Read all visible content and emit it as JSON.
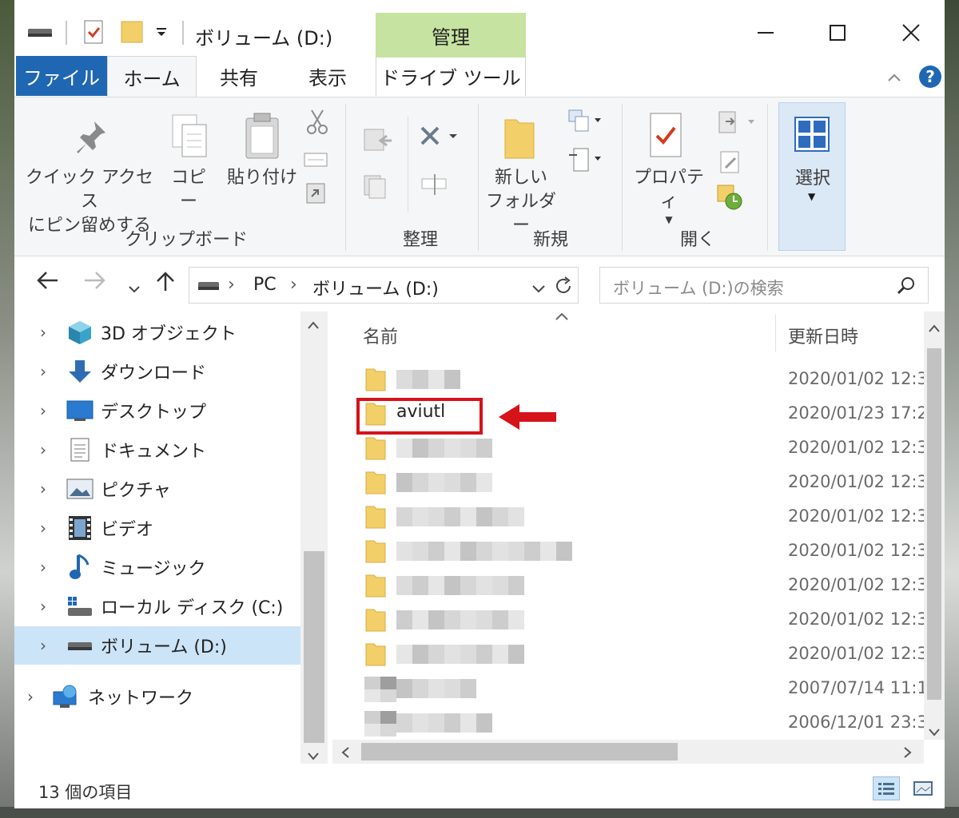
{
  "window": {
    "title": "ボリューム (D:)",
    "manage_tab": "管理"
  },
  "tabs": {
    "file": "ファイル",
    "home": "ホーム",
    "share": "共有",
    "view": "表示",
    "drive_tools": "ドライブ ツール"
  },
  "ribbon": {
    "pin_line1": "クイック アクセス",
    "pin_line2": "にピン留めする",
    "copy": "コピー",
    "paste": "貼り付け",
    "clipboard_group": "クリップボード",
    "organize_group": "整理",
    "new_folder_line1": "新しい",
    "new_folder_line2": "フォルダー",
    "new_group": "新規",
    "properties": "プロパティ",
    "open_group": "開く",
    "select": "選択"
  },
  "address": {
    "pc": "PC",
    "volume": "ボリューム (D:)",
    "search_placeholder": "ボリューム (D:)の検索"
  },
  "nav": [
    {
      "label": "3D オブジェクト",
      "icon": "cube-icon"
    },
    {
      "label": "ダウンロード",
      "icon": "download-icon"
    },
    {
      "label": "デスクトップ",
      "icon": "desktop-icon"
    },
    {
      "label": "ドキュメント",
      "icon": "document-icon"
    },
    {
      "label": "ピクチャ",
      "icon": "picture-icon"
    },
    {
      "label": "ビデオ",
      "icon": "video-icon"
    },
    {
      "label": "ミュージック",
      "icon": "music-icon"
    },
    {
      "label": "ローカル ディスク (C:)",
      "icon": "local-disk-icon"
    },
    {
      "label": "ボリューム (D:)",
      "icon": "drive-icon"
    },
    {
      "label": "ネットワーク",
      "icon": "network-icon"
    }
  ],
  "columns": {
    "name": "名前",
    "modified": "更新日時"
  },
  "files": [
    {
      "name": "",
      "date": "2020/01/02 12:3",
      "type": "folder",
      "blur_width": 80
    },
    {
      "name": "aviutl",
      "date": "2020/01/23 17:2",
      "type": "folder",
      "blur_width": 0
    },
    {
      "name": "",
      "date": "2020/01/02 12:3",
      "type": "folder",
      "blur_width": 120
    },
    {
      "name": "",
      "date": "2020/01/02 12:3",
      "type": "folder",
      "blur_width": 120
    },
    {
      "name": "",
      "date": "2020/01/02 12:3",
      "type": "folder",
      "blur_width": 160
    },
    {
      "name": "",
      "date": "2020/01/02 12:3",
      "type": "folder",
      "blur_width": 220
    },
    {
      "name": "",
      "date": "2020/01/02 12:3",
      "type": "folder",
      "blur_width": 160
    },
    {
      "name": "",
      "date": "2020/01/02 12:3",
      "type": "folder",
      "blur_width": 160
    },
    {
      "name": "",
      "date": "2020/01/02 12:3",
      "type": "folder",
      "blur_width": 160
    },
    {
      "name": "",
      "date": "2007/07/14 11:1",
      "type": "file",
      "blur_width": 100
    },
    {
      "name": "",
      "date": "2006/12/01 23:3",
      "type": "file",
      "blur_width": 120
    }
  ],
  "status": {
    "item_count": "13 個の項目"
  },
  "colors": {
    "file_tab": "#1f67b3",
    "manage_tab": "#c7e3a1",
    "selection": "#cce4f7",
    "highlight": "#d6121a",
    "folder": "#f3cf6a"
  }
}
